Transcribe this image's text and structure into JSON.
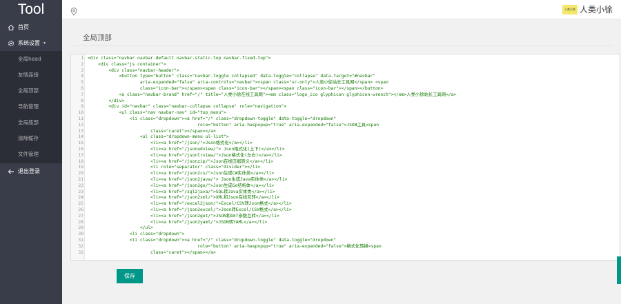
{
  "brand": {
    "logo": "Tool"
  },
  "sidebar": {
    "home": {
      "icon": "home-icon",
      "label": "首页"
    },
    "settings": {
      "icon": "gear-icon",
      "label": "系统设置"
    },
    "sub_items": [
      "全局head",
      "友情连接",
      "全局顶部",
      "导航管理",
      "全局底部",
      "清除缓存",
      "文件管理"
    ],
    "logout": {
      "icon": "arrow-left-icon",
      "label": "退出登录"
    }
  },
  "topbar": {
    "location_icon": "map-pin-icon",
    "avatar_text": "人类小徐",
    "user_name": "人类小徐"
  },
  "page": {
    "title": "全局顶部",
    "save_label": "保存"
  },
  "colors": {
    "sidebar_bg": "#393d49",
    "accent": "#009688",
    "tag_color": "#117700"
  },
  "code_lines": [
    {
      "n": "1",
      "text": "<div class=\"navbar navbar-default navbar-static-top navbar-fixed-top\">"
    },
    {
      "n": "2",
      "text": "    <div class=\"js container\">"
    },
    {
      "n": "3",
      "text": "        <div class=\"navbar-header\">"
    },
    {
      "n": "4",
      "text": "            <button type=\"button\" class=\"navbar-toggle collapsed\" data-toggle=\"collapse\" data-target=\"#navbar\""
    },
    {
      "n": "5",
      "text": "                    aria-expanded=\"false\" aria-controls=\"navbar\"><span class=\"sr-only\">人类小徐站长工具网</span> <span"
    },
    {
      "n": "6",
      "text": "                    class=\"icon-bar\"></span><span class=\"icon-bar\"></span><span class=\"icon-bar\"></span></button>"
    },
    {
      "n": "7",
      "text": "            <a class=\"navbar-brand\" href=\"/\" title=\"人类小徐在线工具网\"><em class=\"logo_ico glyphicon glyphicon-wrench\"></em>人类小徐站长工具网</a>"
    },
    {
      "n": "8",
      "text": "        </div>"
    },
    {
      "n": "9",
      "text": "        <div id=\"navbar\" class=\"navbar-collapse collapse\" role=\"navigation\">"
    },
    {
      "n": "10",
      "text": "            <ul class=\"nav navbar-nav\" id=\"top_menu\">"
    },
    {
      "n": "11",
      "text": "                <li class=\"dropdown\"><a href=\"/\" class=\"dropdown-toggle\" data-toggle=\"dropdown\""
    },
    {
      "n": "12",
      "text": "                                          role=\"button\" aria-haspopup=\"true\" aria-expanded=\"false\">JSON工具<span"
    },
    {
      "n": "13",
      "text": "                        class=\"caret\"></span></a>"
    },
    {
      "n": "14",
      "text": "                    <ul class=\"dropdown-menu ul-list\">"
    },
    {
      "n": "15",
      "text": "                        <li><a href=\"/json/\">Json格式化</a></li>"
    },
    {
      "n": "16",
      "text": "                        <li><a href=\"/jsonudview/\"> Json格式化(上下)</a></li>"
    },
    {
      "n": "17",
      "text": "                        <li><a href=\"/jsonlrview/\">Json格式化(左右)</a></li>"
    },
    {
      "n": "18",
      "text": "                        <li><a href=\"/jsonzip/\">Json在线压缩转义</a></li>"
    },
    {
      "n": "19",
      "text": "                        <li role=\"separator\" class=\"divider\"></li>"
    },
    {
      "n": "20",
      "text": "                        <li><a href=\"/json2cs/\">Json生成C#实体类</a></li>"
    },
    {
      "n": "21",
      "text": "                        <li><a href=\"/json2java/\"> Json生成Java实体类</a></li>"
    },
    {
      "n": "22",
      "text": "                        <li><a href=\"/json2go/\">Json生成Go结构体</a></li>"
    },
    {
      "n": "23",
      "text": "                        <li><a href=\"/sql2java/\">SQL转Java实体类</a></li>"
    },
    {
      "n": "24",
      "text": "                        <li><a href=\"/json2xml/\">XML和Json在线互转</a></li>"
    },
    {
      "n": "25",
      "text": "                        <li><a href=\"/excel2json/\">Excel/CSV转Json格式</a></li>"
    },
    {
      "n": "26",
      "text": "                        <li><a href=\"/json2excel/\">Json转Excel/CSV格式</a></li>"
    },
    {
      "n": "27",
      "text": "                        <li><a href=\"/json2get/\">JSON和GET参数互转</a></li>"
    },
    {
      "n": "28",
      "text": "                        <li><a href=\"/json2yaml/\">JSON转YAML</a></li>"
    },
    {
      "n": "29",
      "text": "                    </ul>"
    },
    {
      "n": "30",
      "text": "                <li class=\"dropdown\">"
    },
    {
      "n": "31",
      "text": "                <li class=\"dropdown\"><a href=\"/\" class=\"dropdown-toggle\" data-toggle=\"dropdown\""
    },
    {
      "n": "32",
      "text": "                                          role=\"button\" aria-haspopup=\"true\" aria-expanded=\"false\">格式化转换<span"
    },
    {
      "n": "33",
      "text": "                        class=\"caret\"></span></a>"
    }
  ]
}
